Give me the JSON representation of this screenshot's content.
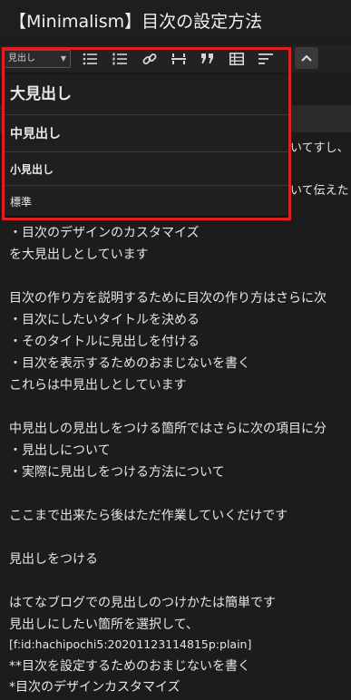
{
  "title": "【Minimalism】目次の設定方法",
  "toolbar": {
    "format_select": "見出し",
    "icons": [
      "list-bullet-icon",
      "list-numbered-icon",
      "link-icon",
      "horizontal-rule-icon",
      "quote-icon",
      "table-icon",
      "more-icon"
    ]
  },
  "dropdown": {
    "items": [
      "大見出し",
      "中見出し",
      "小見出し",
      "標準"
    ]
  },
  "partial_text": [
    "いてすし、",
    "いて伝えた",
    "すさらに次",
    "の項目に分"
  ],
  "lines": [
    "・目次のデザインのカスタマイズ",
    "を大見出しとしています",
    "",
    "目次の作り方を説明するために目次の作り方はさらに次",
    "・目次にしたいタイトルを決める",
    "・そのタイトルに見出しを付ける",
    "・目次を表示するためのおまじないを書く",
    "これらは中見出しとしています",
    "",
    "中見出しの見出しをつける箇所ではさらに次の項目に分",
    "・見出しについて",
    "・実際に見出しをつける方法について",
    "",
    "ここまで出来たら後はただ作業していくだけです",
    "",
    "見出しをつける",
    "",
    "はてなブログでの見出しのつけかたは簡単です",
    "見出しにしたい箇所を選択して、",
    "[f:id:hachipochi5:20201123114815p:plain]",
    "**目次を設定するためのおまじないを書く",
    "*目次のデザインカスタマイズ"
  ],
  "colors": {
    "highlight": "#e02020",
    "background": "#1c1c1c"
  }
}
